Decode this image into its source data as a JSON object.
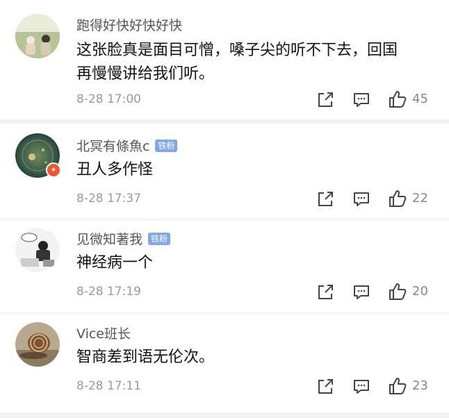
{
  "comments": [
    {
      "username": "跑得好快好快好快",
      "badge": "",
      "text_line1": "这张脸真是面目可憎，嗓子尖的听不下去，回国",
      "text_line2": "再慢慢讲给我们听。",
      "time": "8-28 17:00",
      "likes": "45"
    },
    {
      "username": "北冥有條魚c",
      "badge": "铁粉",
      "text_line1": "丑人多作怪",
      "time": "8-28 17:37",
      "likes": "22"
    },
    {
      "username": "见微知著我",
      "badge": "铁粉",
      "text_line1": "神经病一个",
      "time": "8-28 17:19",
      "likes": "20"
    },
    {
      "username": "Vice班长",
      "badge": "",
      "text_line1": "智商差到语无伦次。",
      "time": "8-28 17:11",
      "likes": "23"
    }
  ],
  "icons": {
    "share": "share-icon",
    "comment": "comment-icon",
    "like": "thumbs-up-icon"
  },
  "colors": {
    "badge": "#7fa8e6",
    "avatar_badge": "#f0552e"
  }
}
